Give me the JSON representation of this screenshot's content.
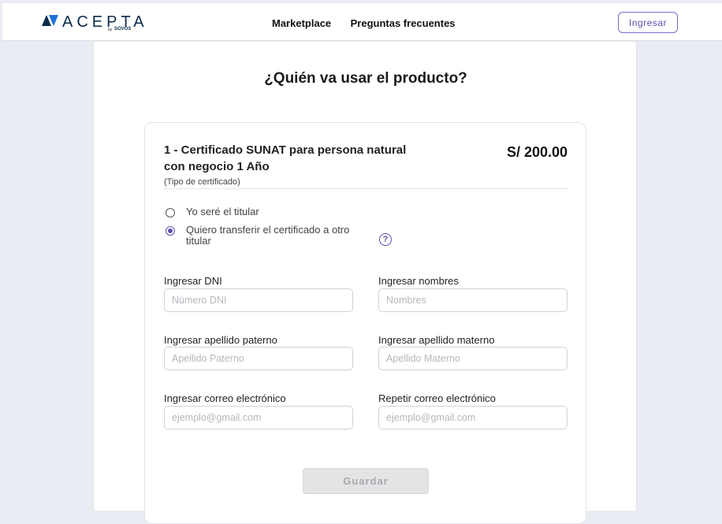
{
  "header": {
    "brand": "ACEPTA",
    "brand_by": "by",
    "brand_sovos": "SOVOS",
    "nav": [
      "Marketplace",
      "Preguntas frecuentes"
    ],
    "login_label": "Ingresar"
  },
  "page": {
    "title": "¿Quién va usar el producto?"
  },
  "product": {
    "title": "1 - Certificado SUNAT para persona natural con negocio 1 Año",
    "type": "(Tipo de certificado)",
    "price": "S/ 200.00"
  },
  "holder_options": [
    {
      "label": "Yo seré el titular",
      "selected": false
    },
    {
      "label": "Quiero transferir el certificado a otro titular",
      "selected": true
    }
  ],
  "help_icon": "question-circle-icon",
  "form": {
    "dni": {
      "label": "Ingresar DNI",
      "placeholder": "Número DNI",
      "value": ""
    },
    "nombres": {
      "label": "Ingresar nombres",
      "placeholder": "Nombres",
      "value": ""
    },
    "paterno": {
      "label": "Ingresar apellido paterno",
      "placeholder": "Apellido Paterno",
      "value": ""
    },
    "materno": {
      "label": "Ingresar apellido materno",
      "placeholder": "Apellido Materno",
      "value": ""
    },
    "correo": {
      "label": "Ingresar correo electrónico",
      "placeholder": "ejemplo@gmail.com",
      "value": ""
    },
    "correo_repetir": {
      "label": "Repetir correo electrónico",
      "placeholder": "ejemplo@gmail.com",
      "value": ""
    },
    "save_label": "Guardar"
  },
  "colors": {
    "accent": "#5b4fb0",
    "brand": "#0b2b4c",
    "background": "#e9ecf2",
    "button_disabled": "#e4e4e6"
  }
}
